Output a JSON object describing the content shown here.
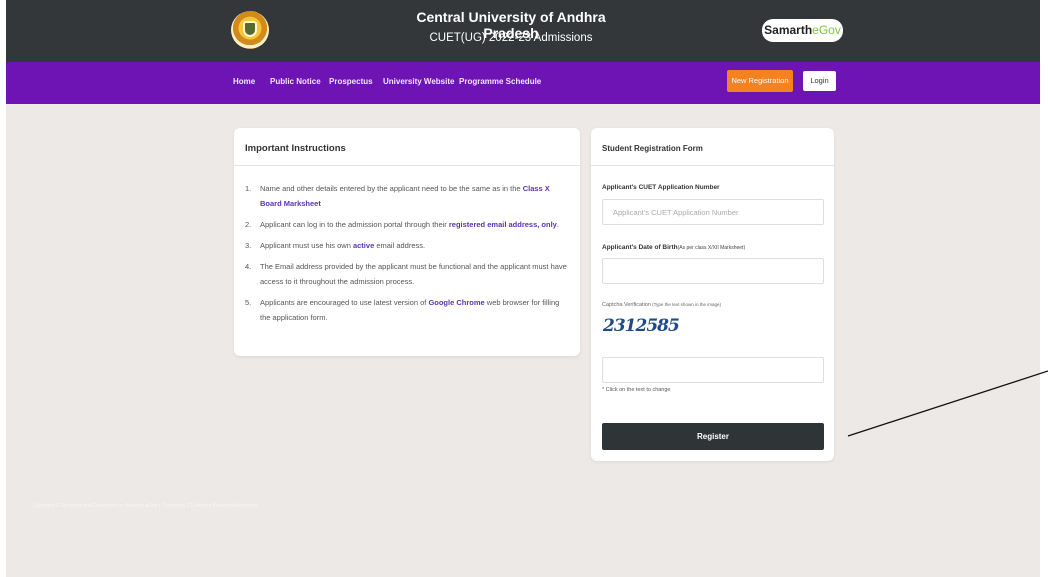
{
  "header": {
    "university_name": "Central University of Andhra Pradesh",
    "subtitle": "CUET(UG) 2022-23 Admissions",
    "samarth_brand": "Samarth",
    "samarth_egov": "eGov"
  },
  "nav": {
    "links": [
      "Home",
      "Public Notice",
      "Prospectus",
      "University Website",
      "Programme Schedule"
    ],
    "new_registration": "New Registration",
    "login": "Login"
  },
  "instructions": {
    "title": "Important Instructions",
    "items": [
      {
        "num": "1.",
        "before": "Name and other details entered by the applicant need to be the same as in the ",
        "highlight": "Class X Board Marksheet",
        "after": ""
      },
      {
        "num": "2.",
        "before": "Applicant can log in to the admission portal through their ",
        "highlight": "registered email address, only",
        "after": "."
      },
      {
        "num": "3.",
        "before": "Applicant must use his own ",
        "highlight": "active",
        "after": " email address."
      },
      {
        "num": "4.",
        "before": "The Email address provided by the applicant must be functional and the applicant must have access to it throughout the admission process.",
        "highlight": "",
        "after": ""
      },
      {
        "num": "5.",
        "before": "Applicants are encouraged to use latest version of ",
        "highlight": "Google Chrome",
        "after": " web browser for filling the application form."
      }
    ]
  },
  "form": {
    "title": "Student Registration Form",
    "cuet_label": "Applicant's CUET Application Number",
    "cuet_placeholder": "Applicant's CUET Application Number",
    "dob_label": "Applicant's Date of Birth",
    "dob_note": "(As per class X/XII Marksheet)",
    "captcha_label": "Captcha Verification",
    "captcha_note": " (Type the text shown in the image)",
    "captcha_text": "2312585",
    "captcha_hint": "* Click on the text to change",
    "register": "Register"
  },
  "footer": {
    "copyright": "Copyright © Designed and Developed by Samarth eGov | Content by CU Andhra Pradesh Admissions"
  },
  "colors": {
    "topbar": "#33373a",
    "navbar": "#6e14b4",
    "accent_orange": "#f58220",
    "highlight_text": "#5a34b0",
    "register_button": "#2f3437"
  }
}
